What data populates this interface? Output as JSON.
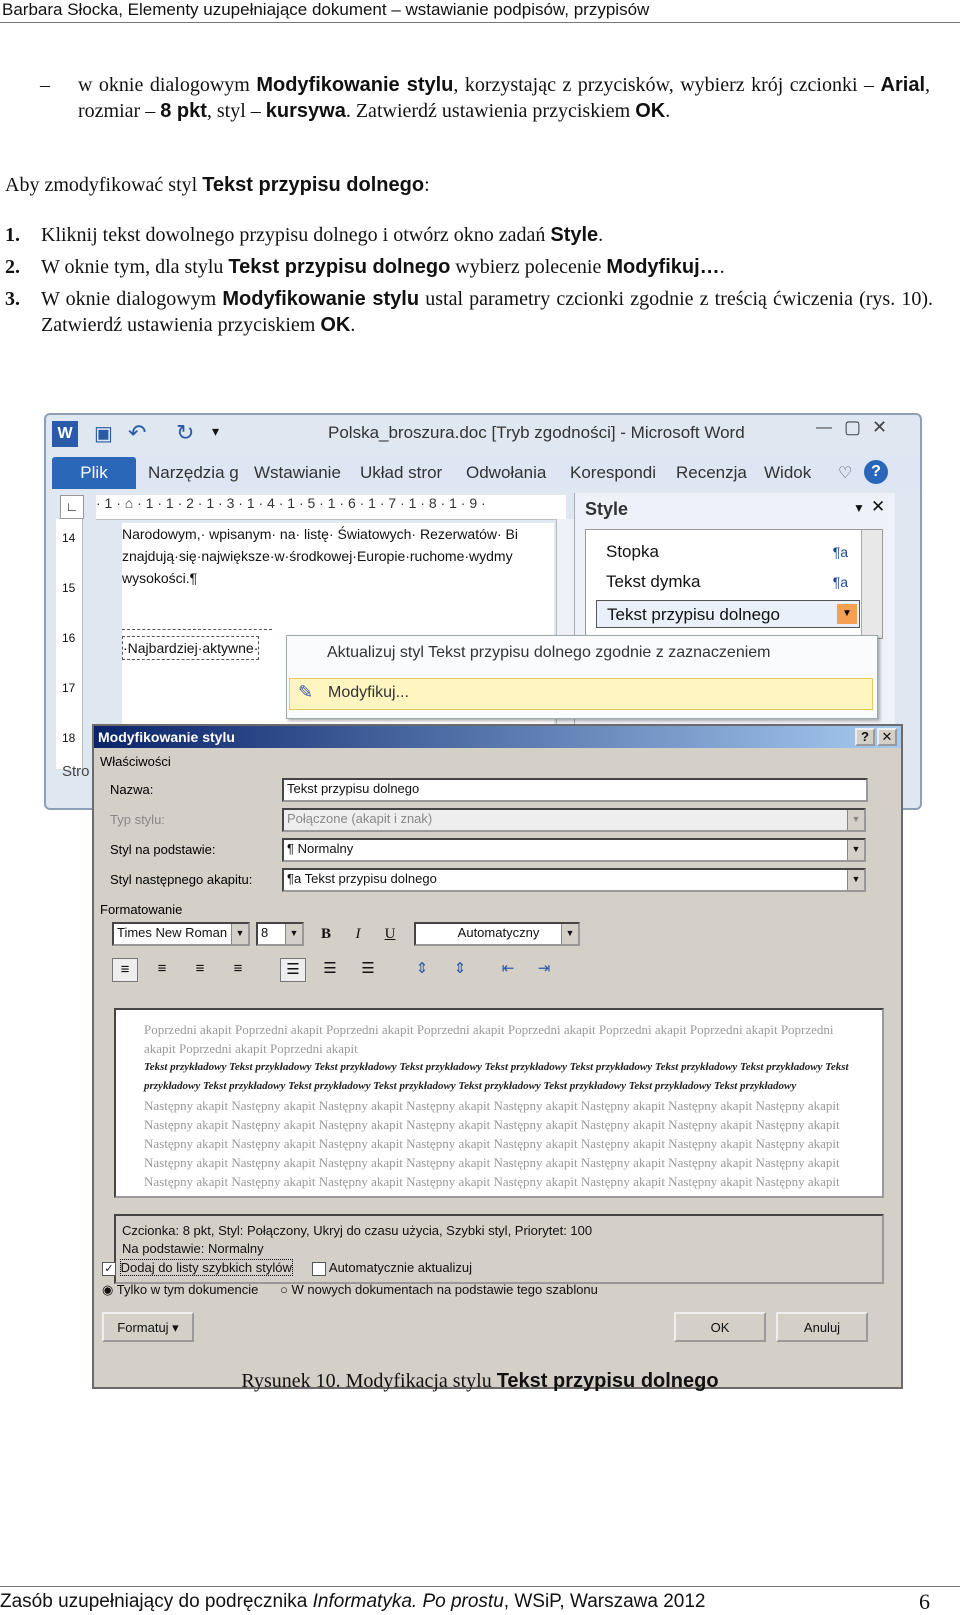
{
  "page_header": "Barbara Słocka, Elementy uzupełniające dokument – wstawianie podpisów, przypisów",
  "bullet": {
    "dash": "–",
    "p1": "w oknie dialogowym ",
    "b1": "Modyfikowanie stylu",
    "p2": ", korzystając z przycisków, wybierz krój czcionki – ",
    "b2": "Arial",
    "p3": ", rozmiar – ",
    "b3": "8 pkt",
    "p4": ", styl – ",
    "b4": "kursywa",
    "p5": ". Zatwierdź ustawienia przyciskiem ",
    "b5": "OK",
    "p6": "."
  },
  "intro": {
    "text": "Aby zmodyfikować styl ",
    "bold": "Tekst przypisu dolnego",
    "end": ":"
  },
  "steps": [
    {
      "num": "1.",
      "a": "Kliknij tekst dowolnego przypisu dolnego i otwórz okno zadań ",
      "b": "Style",
      "c": "."
    },
    {
      "num": "2.",
      "a": "W oknie tym, dla stylu ",
      "b": "Tekst przypisu dolnego",
      "c": " wybierz polecenie ",
      "d": "Modyfikuj…",
      "e": "."
    },
    {
      "num": "3.",
      "a": "W oknie dialogowym ",
      "b": "Modyfikowanie stylu",
      "c": " ustal parametry czcionki zgodnie z treścią ćwiczenia (rys. 10). Zatwierdź ustawienia przyciskiem ",
      "d": "OK",
      "e": "."
    }
  ],
  "word": {
    "title": "Polska_broszura.doc [Tryb zgodności] - Microsoft Word",
    "tabs": [
      "Plik",
      "Narzędzia g",
      "Wstawianie",
      "Układ stror",
      "Odwołania",
      "Korespondi",
      "Recenzja",
      "Widok"
    ],
    "ruler": "· 1 · ⌂ · 1 · 1 · 2 · 1 · 3 · 1 · 4 · 1 · 5 · 1 · 6 · 1 · 7 · 1 · 8 · 1 · 9 ·",
    "vruler": [
      "14",
      "15",
      "16",
      "17",
      "18"
    ],
    "doc_lines": [
      "Narodowym,· wpisanym· na· listę· Światowych· Rezerwatów· Bi",
      "znajdują·się·największe·w·środkowej·Europie·ruchome·wydmy",
      "wysokości.¶"
    ],
    "doc_footnote": "·Najbardziej·aktywne·",
    "status": "Stro",
    "style_pane_title": "Style",
    "style_items": [
      "Stopka",
      "Tekst dymka",
      "Tekst przypisu dolnego"
    ],
    "style_mark": "¶a",
    "context_menu": [
      "Aktualizuj styl Tekst przypisu dolnego zgodnie z zaznaczeniem",
      "Modyfikuj..."
    ]
  },
  "dialog": {
    "title": "Modyfikowanie stylu",
    "help": "?",
    "close": "✕",
    "section_properties": "Właściwości",
    "name_label": "Nazwa:",
    "name_value": "Tekst przypisu dolnego",
    "type_label": "Typ stylu:",
    "type_value": "Połączone (akapit i znak)",
    "based_label": "Styl na podstawie:",
    "based_value": "¶  Normalny",
    "next_label": "Styl następnego akapitu:",
    "next_value": "¶a  Tekst przypisu dolnego",
    "section_format": "Formatowanie",
    "font": "Times New Roman",
    "size": "8",
    "bold": "B",
    "italic": "I",
    "underline": "U",
    "color": "Automatyczny",
    "preview_prev": "Poprzedni akapit Poprzedni akapit Poprzedni akapit Poprzedni akapit Poprzedni akapit Poprzedni akapit Poprzedni akapit Poprzedni akapit Poprzedni akapit Poprzedni akapit",
    "preview_sample": "Tekst przykładowy Tekst przykładowy Tekst przykładowy Tekst przykładowy Tekst przykładowy Tekst przykładowy Tekst przykładowy Tekst przykładowy Tekst przykładowy Tekst przykładowy Tekst przykładowy Tekst przykładowy Tekst przykładowy Tekst przykładowy Tekst przykładowy Tekst przykładowy",
    "preview_next": "Następny akapit Następny akapit Następny akapit Następny akapit Następny akapit Następny akapit Następny akapit Następny akapit Następny akapit Następny akapit Następny akapit Następny akapit Następny akapit Następny akapit Następny akapit Następny akapit Następny akapit Następny akapit Następny akapit Następny akapit Następny akapit Następny akapit Następny akapit Następny akapit Następny akapit Następny akapit Następny akapit Następny akapit Następny akapit Następny akapit Następny akapit Następny akapit Następny akapit Następny akapit Następny akapit Następny akapit Następny akapit Następny akapit Następny akapit Następny akapit",
    "desc_line1": "Czcionka: 8 pkt, Styl: Połączony, Ukryj do czasu użycia, Szybki styl, Priorytet: 100",
    "desc_line2": "Na podstawie: Normalny",
    "chk_quick": "Dodaj do listy szybkich stylów",
    "chk_auto": "Automatycznie aktualizuj",
    "radio_doc": "Tylko w tym dokumencie",
    "radio_tpl": "W nowych dokumentach na podstawie tego szablonu",
    "format_btn": "Formatuj ▾",
    "ok": "OK",
    "cancel": "Anuluj"
  },
  "caption": {
    "text": "Rysunek 10. Modyfikacja stylu ",
    "bold": "Tekst przypisu dolnego"
  },
  "footer": {
    "a": "Zasób uzupełniający do podręcznika ",
    "i": "Informatyka. Po prostu",
    "b": ", WSiP, Warszawa 2012",
    "page": "6"
  }
}
